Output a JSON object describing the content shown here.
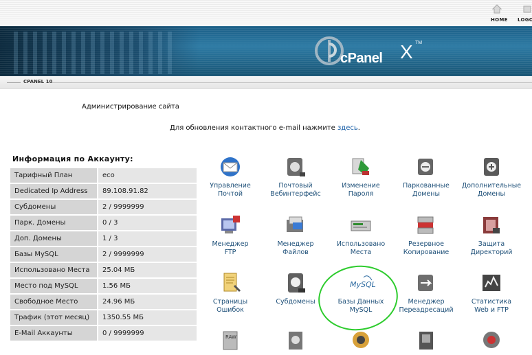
{
  "top_links": {
    "home": "HOME",
    "logout": "LOGO"
  },
  "brand": {
    "name": "cPanel",
    "version_mark": "X",
    "tm": "TM"
  },
  "subbar_label": "CPANEL 10",
  "admin_title": "Администрирование сайта",
  "contact": {
    "text": "Для обновления контактного e-mail нажмите ",
    "link": "здесь",
    "suffix": "."
  },
  "account": {
    "title": "Информация по Аккаунту:",
    "rows": [
      {
        "key": "Тарифный План",
        "value": "eco"
      },
      {
        "key": "Dedicated Ip Address",
        "value": "89.108.91.82"
      },
      {
        "key": "Субдомены",
        "value": "2 / 9999999"
      },
      {
        "key": "Парк. Домены",
        "value": "0 / 3"
      },
      {
        "key": "Доп. Домены",
        "value": "1 / 3"
      },
      {
        "key": "Базы MySQL",
        "value": "2 / 9999999"
      },
      {
        "key": "Использовано Места",
        "value": "25.04 МБ"
      },
      {
        "key": "Место под MySQL",
        "value": "1.56 МБ"
      },
      {
        "key": "Свободное Место",
        "value": "24.96 МБ"
      },
      {
        "key": "Трафик (этот месяц)",
        "value": "1350.55 МБ"
      },
      {
        "key": "E-Mail Аккаунты",
        "value": "0 / 9999999"
      }
    ]
  },
  "tiles": [
    {
      "line1": "Управление",
      "line2": "Почтой",
      "icon": "mail-icon"
    },
    {
      "line1": "Почтовый",
      "line2": "Вебинтерфейс",
      "icon": "webmail-icon"
    },
    {
      "line1": "Изменение",
      "line2": "Пароля",
      "icon": "password-icon"
    },
    {
      "line1": "Паркованные",
      "line2": "Домены",
      "icon": "parked-domains-icon"
    },
    {
      "line1": "Дополнительные",
      "line2": "Домены",
      "icon": "addon-domains-icon"
    },
    {
      "line1": "Менеджер",
      "line2": "FTP",
      "icon": "ftp-icon"
    },
    {
      "line1": "Менеджер",
      "line2": "Файлов",
      "icon": "file-manager-icon"
    },
    {
      "line1": "Использовано",
      "line2": "Места",
      "icon": "disk-usage-icon"
    },
    {
      "line1": "Резервное",
      "line2": "Копирование",
      "icon": "backup-icon"
    },
    {
      "line1": "Защита",
      "line2": "Директорий",
      "icon": "directory-protect-icon"
    },
    {
      "line1": "Страницы",
      "line2": "Ошибок",
      "icon": "error-pages-icon"
    },
    {
      "line1": "Субдомены",
      "line2": "",
      "icon": "subdomains-icon"
    },
    {
      "line1": "Базы Данных",
      "line2": "MySQL",
      "icon": "mysql-icon",
      "logo_text": "MySQL"
    },
    {
      "line1": "Менеджер",
      "line2": "Переадресаций",
      "icon": "redirects-icon"
    },
    {
      "line1": "Статистика",
      "line2": "Web и FTP",
      "icon": "stats-icon"
    }
  ],
  "bottom_icons": [
    "raw-logs-icon",
    "cron-icon",
    "network-tools-icon",
    "mime-icon",
    "misc-icon"
  ],
  "bottom_raw_label": "RAW",
  "highlight_color": "#2ecc2e",
  "link_color": "#1a5fa8"
}
